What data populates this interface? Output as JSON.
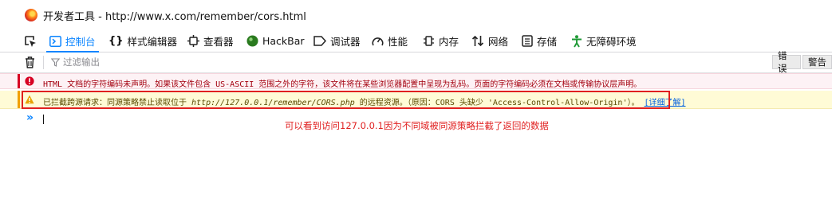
{
  "window": {
    "title": "开发者工具 - http://www.x.com/remember/cors.html"
  },
  "toolbar": {
    "tabs": [
      {
        "label": "控制台",
        "icon": "console-icon",
        "active": true
      },
      {
        "label": "样式编辑器",
        "icon": "braces-icon"
      },
      {
        "label": "查看器",
        "icon": "inspector-icon"
      },
      {
        "label": "HackBar",
        "icon": "hackbar-icon"
      },
      {
        "label": "调试器",
        "icon": "debugger-icon"
      },
      {
        "label": "性能",
        "icon": "performance-icon"
      },
      {
        "label": "内存",
        "icon": "memory-icon"
      },
      {
        "label": "网络",
        "icon": "network-icon"
      },
      {
        "label": "存储",
        "icon": "storage-icon"
      },
      {
        "label": "无障碍环境",
        "icon": "accessibility-icon"
      }
    ]
  },
  "filter": {
    "placeholder": "过滤输出",
    "levels": [
      "错误",
      "警告"
    ]
  },
  "messages": {
    "error": {
      "text": "HTML 文档的字符编码未声明。如果该文件包含 US-ASCII 范围之外的字符，该文件将在某些浏览器配置中呈现为乱码。页面的字符编码必须在文档或传输协议层声明。"
    },
    "warning": {
      "prefix": "已拦截跨源请求：同源策略禁止读取位于 ",
      "url": "http://127.0.0.1/remember/CORS.php",
      "suffix": " 的远程资源。（原因：CORS 头缺少 'Access-Control-Allow-Origin'）。",
      "learn_more": "[详细了解]"
    }
  },
  "console": {
    "prompt": "»"
  },
  "annotation": {
    "text": "可以看到访问127.0.0.1因为不同域被同源策略拦截了返回的数据"
  },
  "colors": {
    "accent": "#0a84ff",
    "error": "#d70022",
    "warning": "#f0a000",
    "annotation": "#e02020"
  }
}
